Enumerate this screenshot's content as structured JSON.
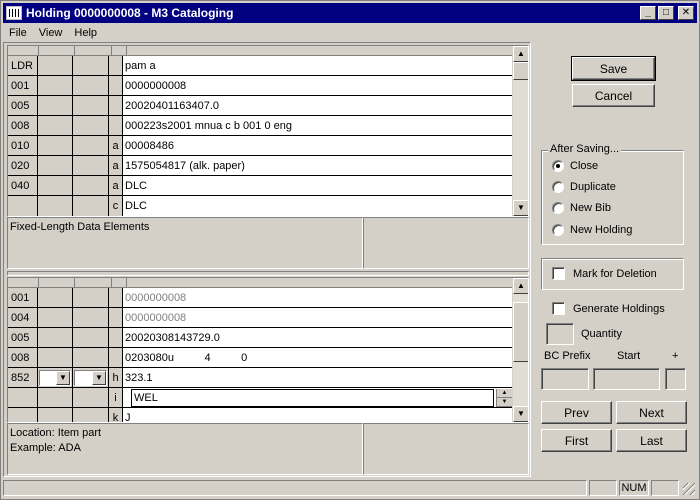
{
  "window": {
    "title": "Holding 0000000008 - M3 Cataloging",
    "minimize": "_",
    "maximize": "□",
    "close": "✕"
  },
  "menu": {
    "file": "File",
    "view": "View",
    "help": "Help"
  },
  "bib_grid": {
    "rows": [
      {
        "tag": "LDR",
        "sub": "",
        "data": "pam   a"
      },
      {
        "tag": "001",
        "sub": "",
        "data": "0000000008"
      },
      {
        "tag": "005",
        "sub": "",
        "data": "20020401163407.0"
      },
      {
        "tag": "008",
        "sub": "",
        "data": "000223s2001    mnua    c b     001 0 eng"
      },
      {
        "tag": "010",
        "sub": "a",
        "data": "  00008486"
      },
      {
        "tag": "020",
        "sub": "a",
        "data": "1575054817 (alk. paper)"
      },
      {
        "tag": "040",
        "sub": "a",
        "data": "DLC"
      },
      {
        "tag": "",
        "sub": "c",
        "data": "DLC"
      }
    ],
    "description": "Fixed-Length Data Elements"
  },
  "holding_grid": {
    "rows": [
      {
        "tag": "001",
        "sub": "",
        "data": "0000000008"
      },
      {
        "tag": "004",
        "sub": "",
        "data": "0000000008"
      },
      {
        "tag": "005",
        "sub": "",
        "data": "20020308143729.0"
      },
      {
        "tag": "008",
        "sub": "",
        "data": "0203080u          4          0"
      },
      {
        "tag": "852",
        "sub": "h",
        "data": "323.1"
      },
      {
        "tag": "",
        "sub": "i",
        "data": "WEL"
      },
      {
        "tag": "",
        "sub": "k",
        "data": "J"
      }
    ],
    "description_line1": "Location: Item part",
    "description_line2": "Example: ADA"
  },
  "actions": {
    "save": "Save",
    "cancel": "Cancel"
  },
  "after_saving": {
    "legend": "After Saving...",
    "options": [
      "Close",
      "Duplicate",
      "New Bib",
      "New Holding"
    ],
    "selected": "Close"
  },
  "mark_for_deletion": "Mark for Deletion",
  "generate_holdings": "Generate Holdings",
  "quantity": "Quantity",
  "bc_prefix": "BC Prefix",
  "start": "Start",
  "plus": "+",
  "nav": {
    "prev": "Prev",
    "next": "Next",
    "first": "First",
    "last": "Last"
  },
  "status": {
    "num": "NUM"
  }
}
